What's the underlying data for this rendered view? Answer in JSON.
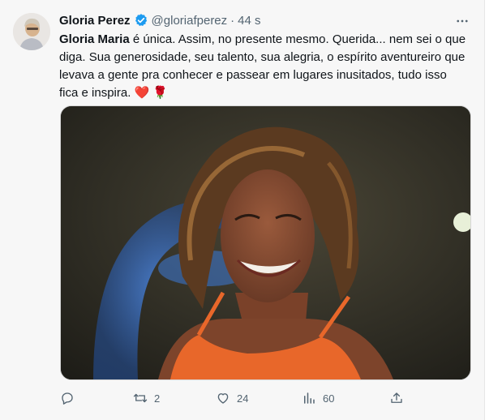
{
  "tweet": {
    "author_name": "Gloria Perez",
    "handle": "@gloriafperez",
    "separator": "·",
    "time": "44 s",
    "more_label": "···",
    "text_bold": "Gloria Maria",
    "text_body": " é  única. Assim, no presente mesmo. Querida... nem sei o que diga. Sua generosidade, seu talento, sua alegria, o espírito aventureiro que levava a gente pra conhecer e passear em lugares inusitados, tudo isso fica e inspira. ",
    "emoji_heart": "❤️",
    "emoji_rose": "🌹"
  },
  "actions": {
    "reply_count": "",
    "retweet_count": "2",
    "like_count": "24",
    "views_count": "60"
  },
  "colors": {
    "verified": "#1d9bf0",
    "muted": "#536471",
    "dress": "#e8672a"
  },
  "icons": {
    "verified": "verified-badge-icon",
    "reply": "reply-icon",
    "retweet": "retweet-icon",
    "like": "heart-icon",
    "views": "views-icon",
    "share": "share-icon",
    "more": "more-icon"
  }
}
